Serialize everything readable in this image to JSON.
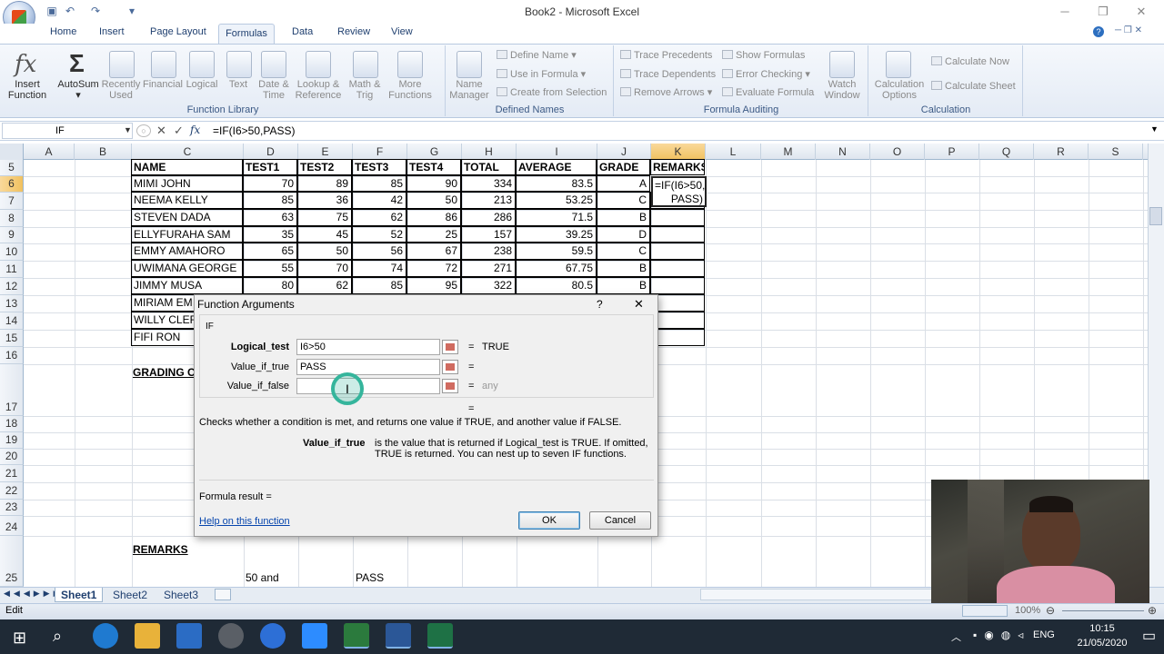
{
  "title_bar": {
    "title": "Book2 - Microsoft Excel"
  },
  "ribbon_tabs": [
    "Home",
    "Insert",
    "Page Layout",
    "Formulas",
    "Data",
    "Review",
    "View"
  ],
  "active_tab": "Formulas",
  "ribbon": {
    "function_library": {
      "label": "Function Library",
      "buttons": [
        {
          "l1": "Insert",
          "l2": "Function"
        },
        {
          "l1": "AutoSum",
          "l2": ""
        },
        {
          "l1": "Recently",
          "l2": "Used"
        },
        {
          "l1": "Financial",
          "l2": ""
        },
        {
          "l1": "Logical",
          "l2": ""
        },
        {
          "l1": "Text",
          "l2": ""
        },
        {
          "l1": "Date &",
          "l2": "Time"
        },
        {
          "l1": "Lookup &",
          "l2": "Reference"
        },
        {
          "l1": "Math &",
          "l2": "Trig"
        },
        {
          "l1": "More",
          "l2": "Functions"
        }
      ]
    },
    "defined_names": {
      "label": "Defined Names",
      "name_manager_l1": "Name",
      "name_manager_l2": "Manager",
      "define_name": "Define Name",
      "use_in_formula": "Use in Formula",
      "create_from_selection": "Create from Selection"
    },
    "formula_auditing": {
      "label": "Formula Auditing",
      "trace_precedents": "Trace Precedents",
      "trace_dependents": "Trace Dependents",
      "remove_arrows": "Remove Arrows",
      "show_formulas": "Show Formulas",
      "error_checking": "Error Checking",
      "evaluate_formula": "Evaluate Formula",
      "watch_l1": "Watch",
      "watch_l2": "Window"
    },
    "calculation": {
      "label": "Calculation",
      "options_l1": "Calculation",
      "options_l2": "Options",
      "calculate_now": "Calculate Now",
      "calculate_sheet": "Calculate Sheet"
    }
  },
  "formula_bar": {
    "name_box": "IF",
    "fx": "fx",
    "formula": "=IF(I6>50,PASS)"
  },
  "columns": [
    "A",
    "B",
    "C",
    "D",
    "E",
    "F",
    "G",
    "H",
    "I",
    "J",
    "K",
    "L",
    "M",
    "N",
    "O",
    "P",
    "Q",
    "R",
    "S"
  ],
  "row_numbers": [
    "5",
    "6",
    "7",
    "8",
    "9",
    "10",
    "11",
    "12",
    "13",
    "14",
    "15",
    "16",
    "17",
    "18",
    "19",
    "20",
    "21",
    "22",
    "23",
    "24",
    "25"
  ],
  "table": {
    "headers": [
      "NAME",
      "TEST1",
      "TEST2",
      "TEST3",
      "TEST4",
      "TOTAL",
      "AVERAGE",
      "GRADE",
      "REMARKS"
    ],
    "rows": [
      [
        "MIMI JOHN",
        "70",
        "89",
        "85",
        "90",
        "334",
        "83.5",
        "A"
      ],
      [
        "NEEMA KELLY",
        "85",
        "36",
        "42",
        "50",
        "213",
        "53.25",
        "C"
      ],
      [
        "STEVEN DADA",
        "63",
        "75",
        "62",
        "86",
        "286",
        "71.5",
        "B"
      ],
      [
        "ELLYFURAHA SAM",
        "35",
        "45",
        "52",
        "25",
        "157",
        "39.25",
        "D"
      ],
      [
        "EMMY AMAHORO",
        "65",
        "50",
        "56",
        "67",
        "238",
        "59.5",
        "C"
      ],
      [
        "UWIMANA GEORGE",
        "55",
        "70",
        "74",
        "72",
        "271",
        "67.75",
        "B"
      ],
      [
        "JIMMY MUSA",
        "80",
        "62",
        "85",
        "95",
        "322",
        "80.5",
        "B"
      ],
      [
        "MIRIAM EM",
        "",
        "",
        "",
        "",
        "",
        "",
        ""
      ],
      [
        "WILLY CLER",
        "",
        "",
        "",
        "",
        "",
        "",
        ""
      ],
      [
        "FIFI RON",
        "",
        "",
        "",
        "",
        "",
        "",
        ""
      ]
    ],
    "k6_line1": "=IF(I6>50,",
    "k6_line2": "PASS)"
  },
  "grading_label": "GRADING C",
  "remarks_label": "REMARKS",
  "row26": {
    "c1": "50 and",
    "c2": "PASS"
  },
  "dialog": {
    "title": "Function Arguments",
    "help_glyph": "?",
    "close_glyph": "✕",
    "function_name": "IF",
    "args": [
      {
        "label": "Logical_test",
        "value": "I6>50",
        "result": "TRUE"
      },
      {
        "label": "Value_if_true",
        "value": "PASS",
        "result": ""
      },
      {
        "label": "Value_if_false",
        "value": "",
        "result": "any"
      }
    ],
    "eq": "=",
    "description": "Checks whether a condition is met, and returns one value if TRUE, and another value if FALSE.",
    "arg_help_name": "Value_if_true",
    "arg_help_text_1": "is the value that is returned if Logical_test is TRUE. If omitted,",
    "arg_help_text_2": "TRUE is returned. You can nest up to seven IF functions.",
    "formula_result": "Formula result =",
    "help_link": "Help on this function",
    "ok": "OK",
    "cancel": "Cancel"
  },
  "sheets": [
    "Sheet1",
    "Sheet2",
    "Sheet3"
  ],
  "active_sheet": "Sheet1",
  "status": {
    "mode": "Edit",
    "zoom": "100%"
  },
  "taskbar": {
    "time": "10:15",
    "date": "21/05/2020",
    "lang": "ENG"
  }
}
